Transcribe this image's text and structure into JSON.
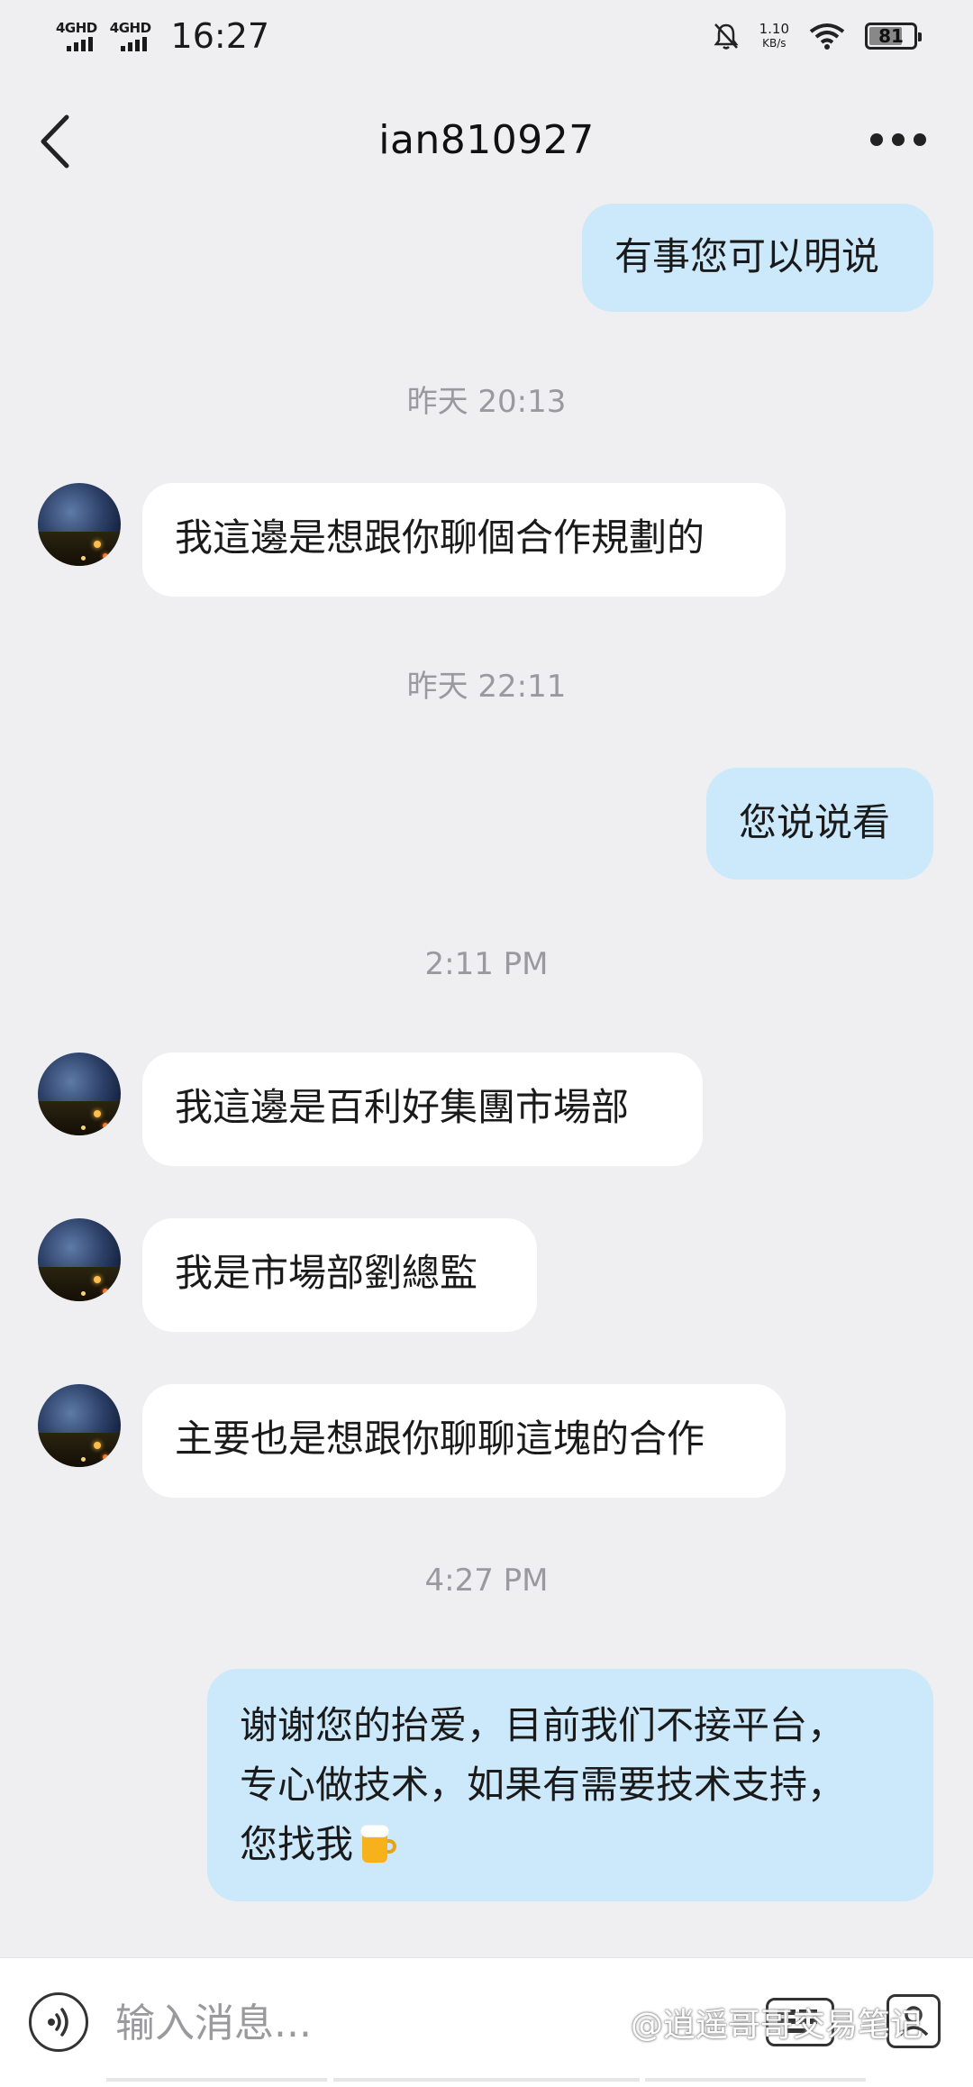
{
  "status_bar": {
    "signal1": "4GHD",
    "signal2": "4GHD",
    "time": "16:27",
    "net_speed_value": "1.10",
    "net_speed_unit": "KB/s",
    "battery": "81"
  },
  "header": {
    "title": "ian810927"
  },
  "messages": [
    {
      "type": "out",
      "text": "有事您可以明说"
    },
    {
      "type": "timestamp",
      "text": "昨天 20:13"
    },
    {
      "type": "in",
      "text": "我這邊是想跟你聊個合作規劃的"
    },
    {
      "type": "timestamp",
      "text": "昨天 22:11"
    },
    {
      "type": "out",
      "text": "您说说看"
    },
    {
      "type": "timestamp",
      "text": "2:11 PM"
    },
    {
      "type": "in",
      "text": "我這邊是百利好集團市場部"
    },
    {
      "type": "in",
      "text": "我是市場部劉總監"
    },
    {
      "type": "in",
      "text": "主要也是想跟你聊聊這塊的合作"
    },
    {
      "type": "timestamp",
      "text": "4:27 PM"
    },
    {
      "type": "out",
      "lines": [
        "谢谢您的抬爱，目前我们不接平台，",
        "专心做技术，如果有需要技术支持，",
        "您找我"
      ],
      "emoji": "beer-mug-icon"
    }
  ],
  "input_bar": {
    "placeholder": "输入消息..."
  },
  "watermark": "@逍遥哥哥交易笔记"
}
